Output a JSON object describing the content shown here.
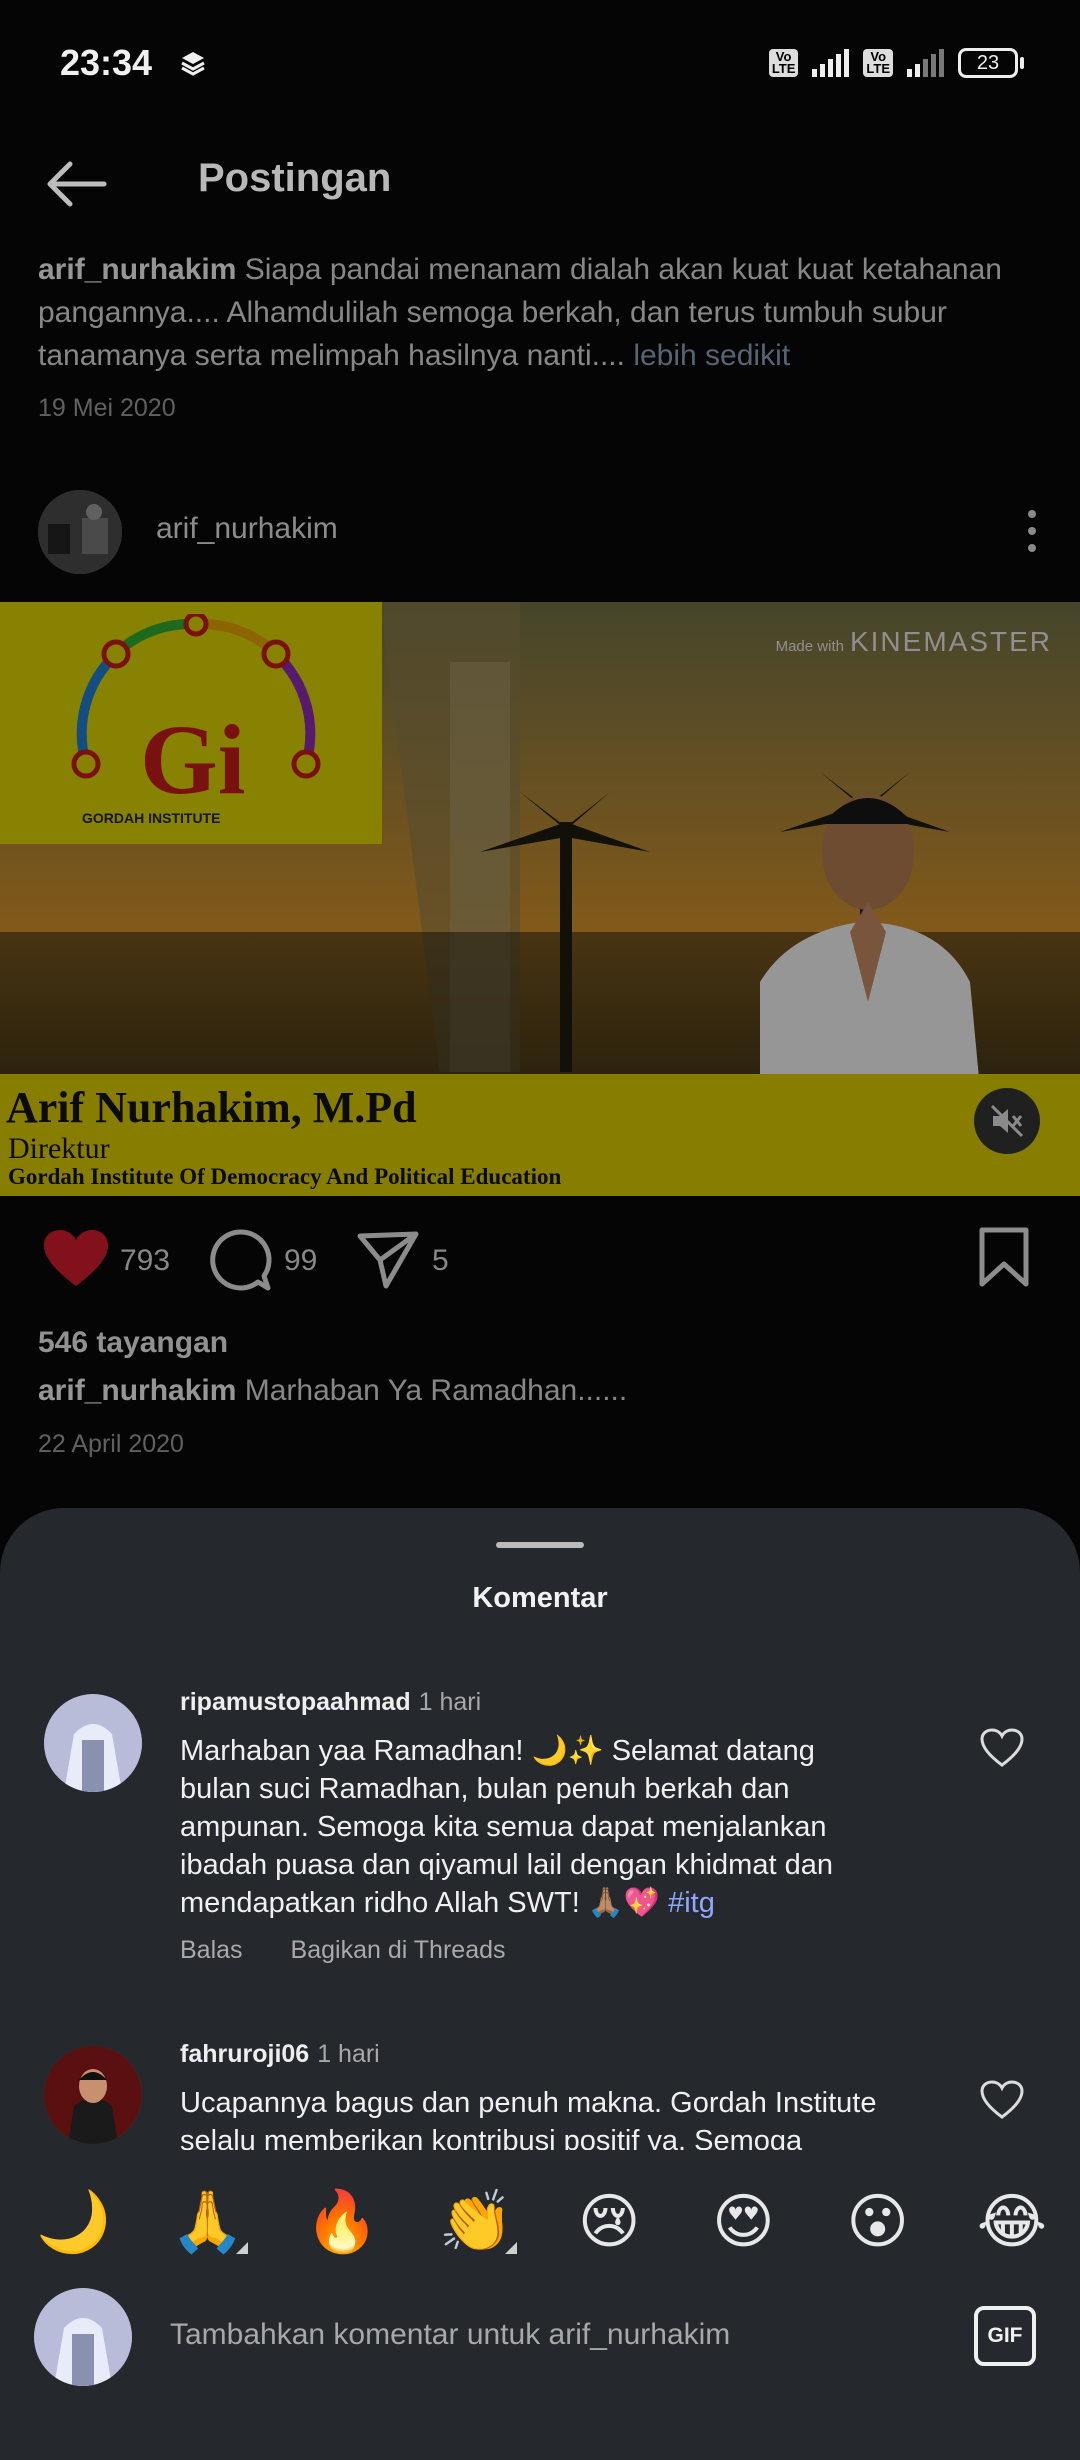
{
  "status_bar": {
    "time": "23:34",
    "battery": "23"
  },
  "header": {
    "title": "Postingan"
  },
  "prev_post": {
    "username": "arif_nurhakim",
    "caption": "Siapa pandai menanam dialah akan kuat kuat ketahanan pangannya.... Alhamdulilah semoga berkah, dan terus tumbuh subur tanamanya serta melimpah hasilnya nanti....",
    "more": "lebih sedikit",
    "date": "19 Mei 2020"
  },
  "post": {
    "username": "arif_nurhakim",
    "video": {
      "watermark_prefix": "Made with",
      "watermark_brand": "KINEMASTER",
      "logo_letters": "Gi",
      "logo_text": "GORDAH INSTITUTE",
      "name": "Arif Nurhakim, M.Pd",
      "role": "Direktur",
      "org": "Gordah Institute Of Democracy And Political Education"
    },
    "likes": "793",
    "comments": "99",
    "shares": "5",
    "views": "546 tayangan",
    "caption": "Marhaban Ya Ramadhan......",
    "date": "22 April 2020"
  },
  "comments_sheet": {
    "title": "Komentar",
    "comments": [
      {
        "username": "ripamustopaahmad",
        "time": "1 hari",
        "text_lines": [
          "Marhaban yaa Ramadhan! 🌙✨ Selamat datang",
          "bulan suci Ramadhan, bulan penuh berkah dan",
          "ampunan. Semoga kita semua dapat menjalankan",
          "ibadah puasa dan qiyamul lail dengan khidmat dan",
          "mendapatkan ridho Allah SWT! 🙏🏽💖"
        ],
        "hashtag": "#itg",
        "reply": "Balas",
        "share": "Bagikan di Threads"
      },
      {
        "username": "fahruroji06",
        "time": "1 hari",
        "text_lines": [
          "Ucapannya bagus dan penuh makna.  Gordah Institute",
          "selalu memberikan kontribusi positif ya.  Semoga"
        ]
      }
    ],
    "emojis": [
      "🌙",
      "🙏",
      "🔥",
      "👏",
      "😢",
      "😍",
      "😮",
      "😂"
    ],
    "input_placeholder": "Tambahkan komentar untuk arif_nurhakim",
    "gif_label": "GIF"
  },
  "colors": {
    "like_red": "#d11a2a",
    "sheet_bg": "#25282d",
    "hashtag": "#8fa8ff"
  }
}
